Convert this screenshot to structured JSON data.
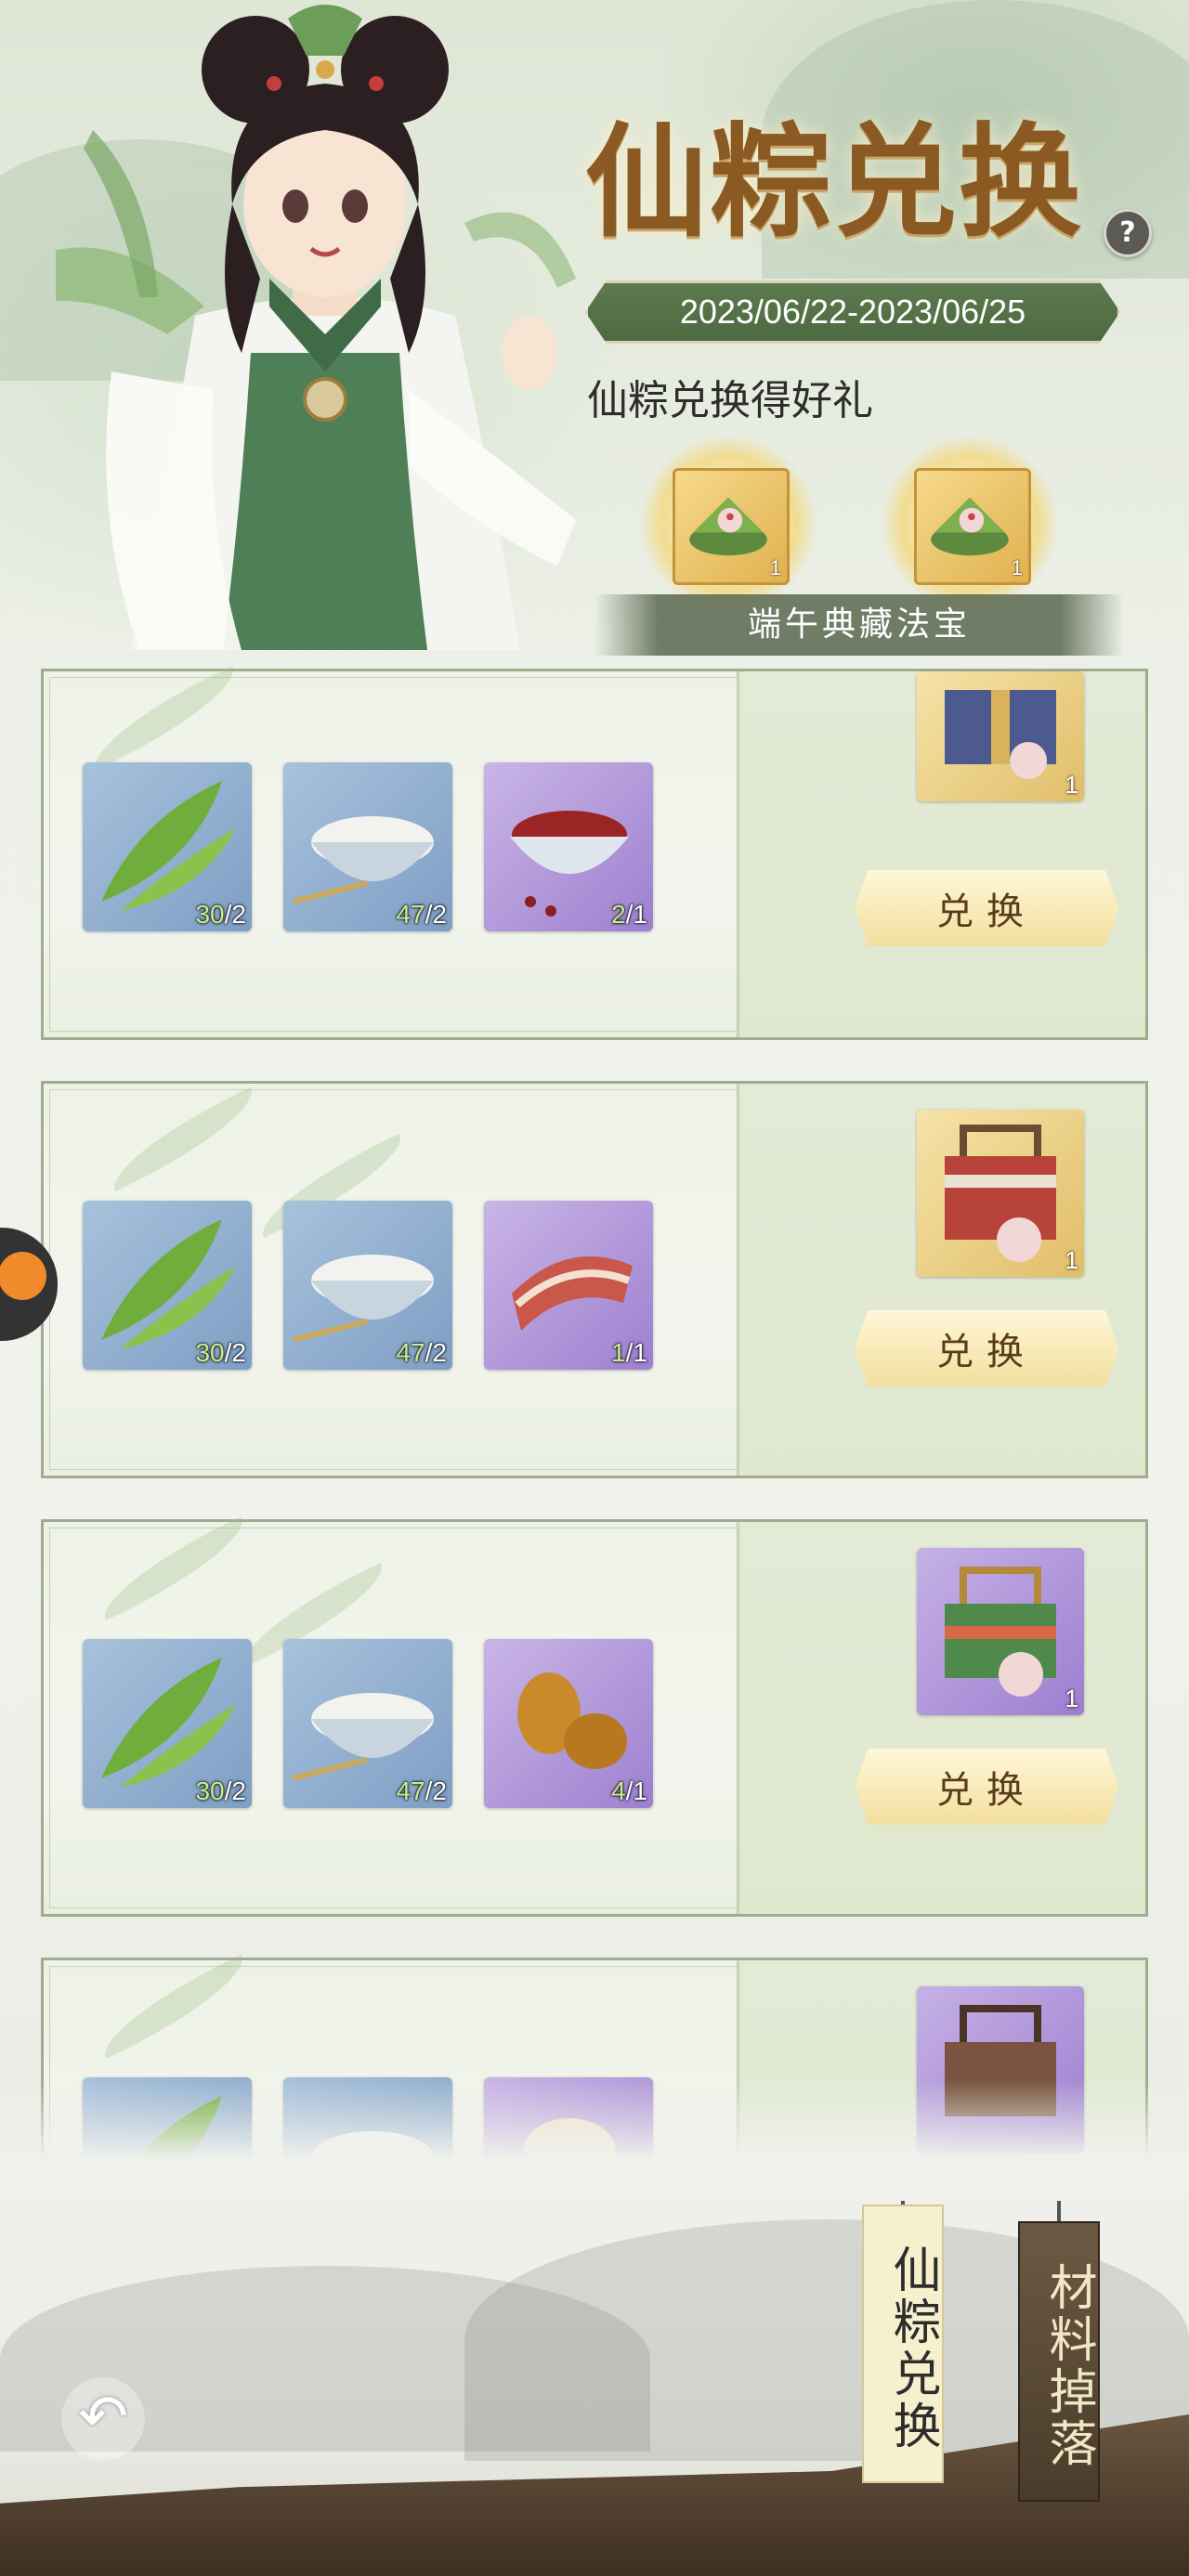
{
  "header": {
    "title": "仙粽兑换",
    "date_range": "2023/06/22-2023/06/25",
    "reward_heading": "仙粽兑换得好礼",
    "rewards": [
      {
        "icon": "zongzi-treasure-icon",
        "count": "1"
      },
      {
        "icon": "zongzi-treasure-icon",
        "count": "1"
      }
    ],
    "reward_label": "端午典藏法宝",
    "help_label": "?"
  },
  "exchanges": [
    {
      "materials": [
        {
          "icon": "bamboo-leaf-icon",
          "have": "30",
          "need": "2",
          "rarity": "blue"
        },
        {
          "icon": "rice-bowl-icon",
          "have": "47",
          "need": "2",
          "rarity": "blue"
        },
        {
          "icon": "red-bean-bowl-icon",
          "have": "2",
          "need": "1",
          "rarity": "purple"
        }
      ],
      "prize": {
        "icon": "blue-gift-box-icon",
        "count": "1",
        "rarity": "gold"
      },
      "button": "兑换"
    },
    {
      "materials": [
        {
          "icon": "bamboo-leaf-icon",
          "have": "30",
          "need": "2",
          "rarity": "blue"
        },
        {
          "icon": "rice-bowl-icon",
          "have": "47",
          "need": "2",
          "rarity": "blue"
        },
        {
          "icon": "pork-belly-icon",
          "have": "1",
          "need": "1",
          "rarity": "purple"
        }
      ],
      "prize": {
        "icon": "red-gift-box-icon",
        "count": "1",
        "rarity": "gold"
      },
      "button": "兑换"
    },
    {
      "materials": [
        {
          "icon": "bamboo-leaf-icon",
          "have": "30",
          "need": "2",
          "rarity": "blue"
        },
        {
          "icon": "rice-bowl-icon",
          "have": "47",
          "need": "2",
          "rarity": "blue"
        },
        {
          "icon": "red-date-icon",
          "have": "4",
          "need": "1",
          "rarity": "purple"
        }
      ],
      "prize": {
        "icon": "green-gift-box-icon",
        "count": "1",
        "rarity": "purple"
      },
      "button": "兑换"
    },
    {
      "materials": [
        {
          "icon": "bamboo-leaf-icon",
          "rarity": "blue"
        },
        {
          "icon": "rice-bowl-icon",
          "rarity": "blue"
        },
        {
          "icon": "salted-egg-icon",
          "rarity": "purple"
        }
      ],
      "prize": {
        "icon": "brown-gift-box-icon",
        "rarity": "purple"
      }
    }
  ],
  "tabs": [
    {
      "label": "仙粽兑换",
      "active": true
    },
    {
      "label": "材料掉落",
      "active": false
    }
  ],
  "colors": {
    "have_ok": "#c9ef8c",
    "title": "#8a5a22",
    "date_bar": "#4c6a40"
  }
}
